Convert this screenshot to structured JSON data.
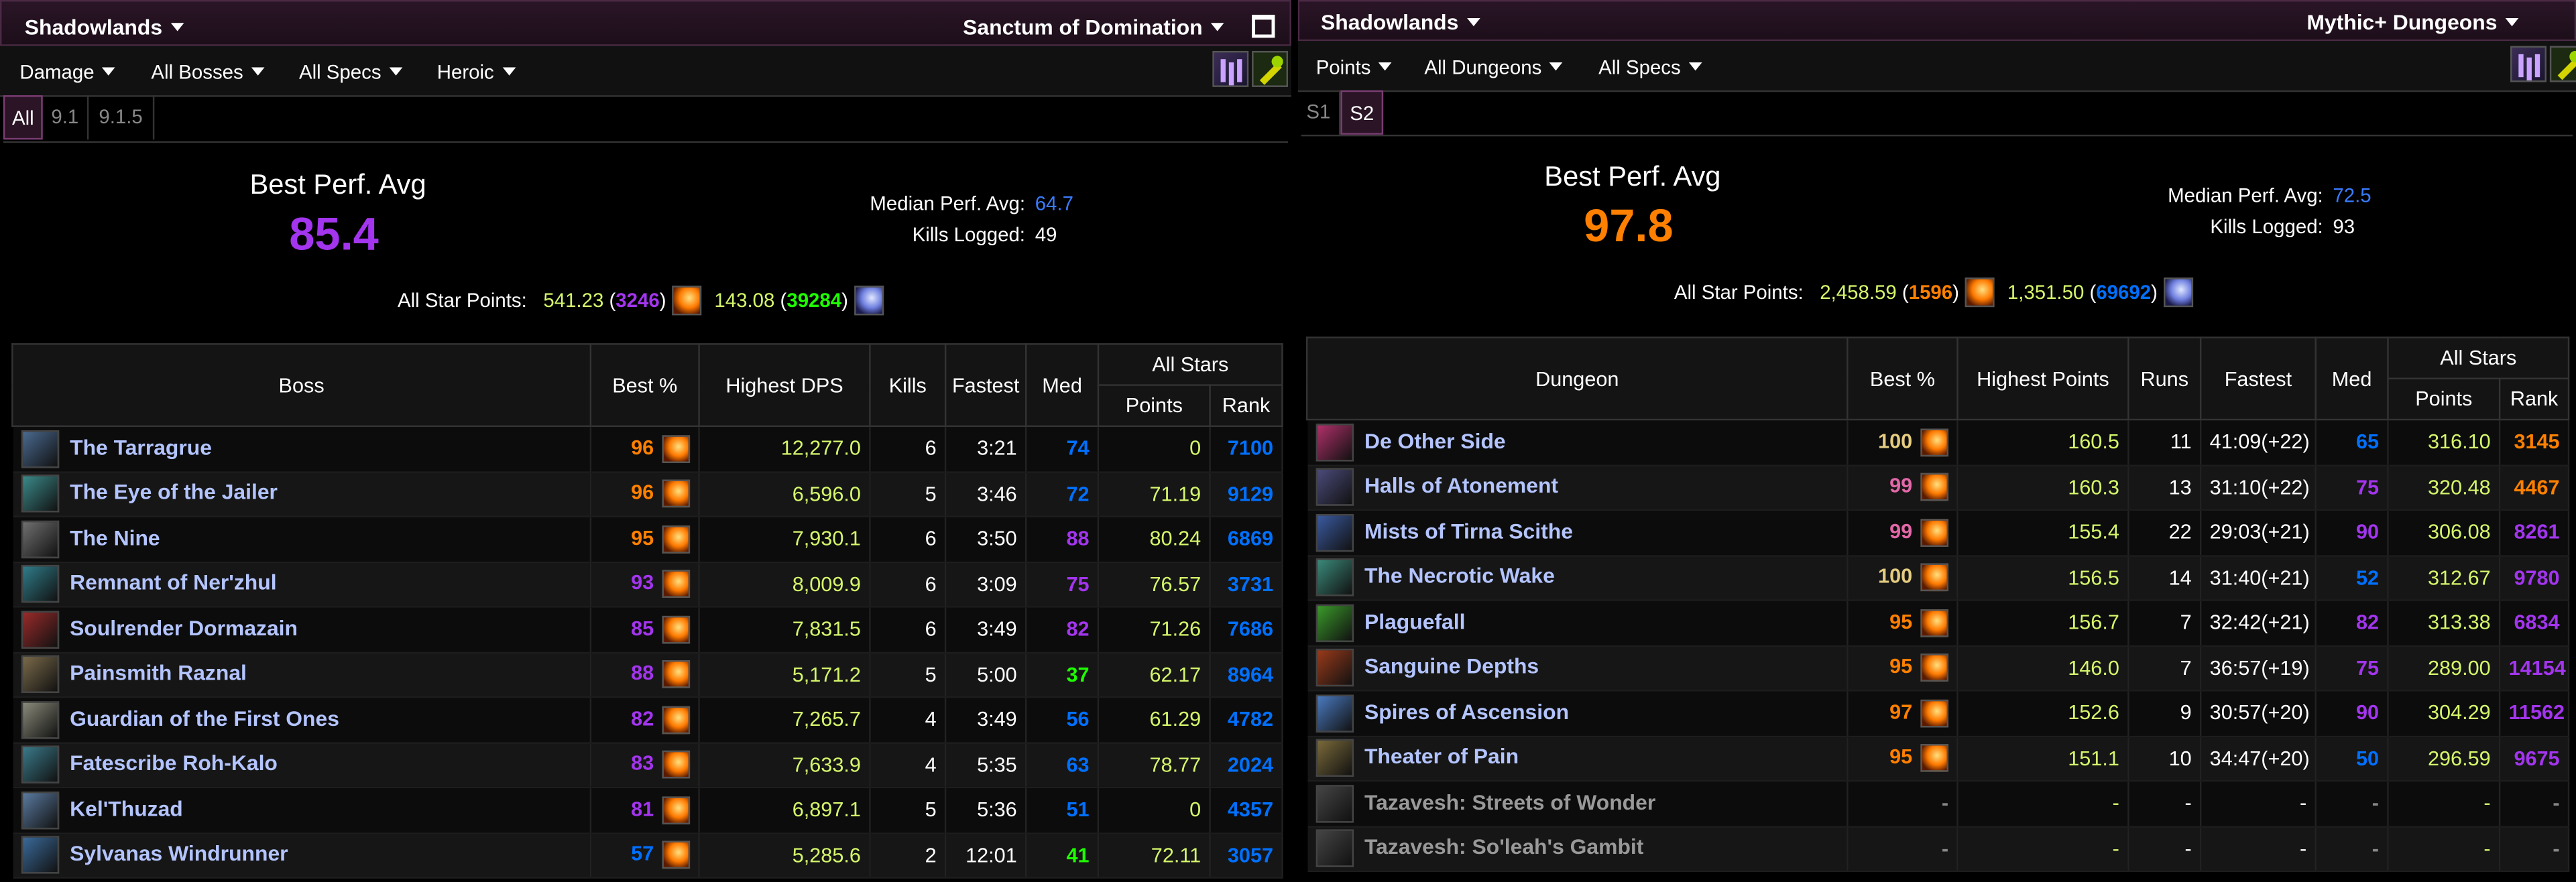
{
  "left": {
    "expansion": "Shadowlands",
    "zone": "Sanctum of Domination",
    "filters": [
      "Damage",
      "All Bosses",
      "All Specs",
      "Heroic"
    ],
    "tabs": [
      "All",
      "9.1",
      "9.1.5"
    ],
    "best_perf_label": "Best Perf. Avg",
    "best_perf_value": "85.4",
    "best_perf_color": "#a335ee",
    "median_label": "Median Perf. Avg:",
    "median_value": "64.7",
    "kills_label": "Kills Logged:",
    "kills_value": "49",
    "allstar_label": "All Star Points:",
    "allstar_1_points": "541.23",
    "allstar_1_rank": "3246",
    "allstar_1_rank_color": "#a335ee",
    "allstar_2_points": "143.08",
    "allstar_2_rank": "39284",
    "allstar_2_rank_color": "#1eff00",
    "headers": {
      "name": "Boss",
      "best": "Best %",
      "highest": "Highest DPS",
      "count": "Kills",
      "fastest": "Fastest",
      "med": "Med",
      "allstars": "All Stars",
      "points": "Points",
      "rank": "Rank"
    },
    "rows": [
      {
        "name": "The Tarragrue",
        "best": "96",
        "best_color": "#ff8000",
        "highest": "12,277.0",
        "count": "6",
        "fastest": "3:21",
        "med": "74",
        "med_color": "#0070ff",
        "points": "0",
        "rank": "7100",
        "rank_color": "#0070ff",
        "icon_color": "#4a6a90"
      },
      {
        "name": "The Eye of the Jailer",
        "best": "96",
        "best_color": "#ff8000",
        "highest": "6,596.0",
        "count": "5",
        "fastest": "3:46",
        "med": "72",
        "med_color": "#0070ff",
        "points": "71.19",
        "rank": "9129",
        "rank_color": "#0070ff",
        "icon_color": "#3b8a8a"
      },
      {
        "name": "The Nine",
        "best": "95",
        "best_color": "#ff8000",
        "highest": "7,930.1",
        "count": "6",
        "fastest": "3:50",
        "med": "88",
        "med_color": "#a335ee",
        "points": "80.24",
        "rank": "6869",
        "rank_color": "#0070ff",
        "icon_color": "#707070"
      },
      {
        "name": "Remnant of Ner'zhul",
        "best": "93",
        "best_color": "#a335ee",
        "highest": "8,009.9",
        "count": "6",
        "fastest": "3:09",
        "med": "75",
        "med_color": "#a335ee",
        "points": "76.57",
        "rank": "3731",
        "rank_color": "#0070ff",
        "icon_color": "#2f7d8a"
      },
      {
        "name": "Soulrender Dormazain",
        "best": "85",
        "best_color": "#a335ee",
        "highest": "7,831.5",
        "count": "6",
        "fastest": "3:49",
        "med": "82",
        "med_color": "#a335ee",
        "points": "71.26",
        "rank": "7686",
        "rank_color": "#0070ff",
        "icon_color": "#9a2a2a"
      },
      {
        "name": "Painsmith Raznal",
        "best": "88",
        "best_color": "#a335ee",
        "highest": "5,171.2",
        "count": "5",
        "fastest": "5:00",
        "med": "37",
        "med_color": "#1eff00",
        "points": "62.17",
        "rank": "8964",
        "rank_color": "#0070ff",
        "icon_color": "#7a6a4a"
      },
      {
        "name": "Guardian of the First Ones",
        "best": "82",
        "best_color": "#a335ee",
        "highest": "7,265.7",
        "count": "4",
        "fastest": "3:49",
        "med": "56",
        "med_color": "#0070ff",
        "points": "61.29",
        "rank": "4782",
        "rank_color": "#0070ff",
        "icon_color": "#8a8a7a"
      },
      {
        "name": "Fatescribe Roh-Kalo",
        "best": "83",
        "best_color": "#a335ee",
        "highest": "7,633.9",
        "count": "4",
        "fastest": "5:35",
        "med": "63",
        "med_color": "#0070ff",
        "points": "78.77",
        "rank": "2024",
        "rank_color": "#0070ff",
        "icon_color": "#3a7a8a"
      },
      {
        "name": "Kel'Thuzad",
        "best": "81",
        "best_color": "#a335ee",
        "highest": "6,897.1",
        "count": "5",
        "fastest": "5:36",
        "med": "51",
        "med_color": "#0070ff",
        "points": "0",
        "rank": "4357",
        "rank_color": "#0070ff",
        "icon_color": "#5a7aa0"
      },
      {
        "name": "Sylvanas Windrunner",
        "best": "57",
        "best_color": "#0070ff",
        "highest": "5,285.6",
        "count": "2",
        "fastest": "12:01",
        "med": "41",
        "med_color": "#1eff00",
        "points": "72.11",
        "rank": "3057",
        "rank_color": "#0070ff",
        "icon_color": "#3a6a9a"
      }
    ]
  },
  "right": {
    "expansion": "Shadowlands",
    "zone": "Mythic+ Dungeons",
    "filters": [
      "Points",
      "All Dungeons",
      "All Specs"
    ],
    "tabs": [
      "S1",
      "S2"
    ],
    "best_perf_label": "Best Perf. Avg",
    "best_perf_value": "97.8",
    "best_perf_color": "#ff8000",
    "median_label": "Median Perf. Avg:",
    "median_value": "72.5",
    "kills_label": "Kills Logged:",
    "kills_value": "93",
    "allstar_label": "All Star Points:",
    "allstar_1_points": "2,458.59",
    "allstar_1_rank": "1596",
    "allstar_1_rank_color": "#ff8000",
    "allstar_2_points": "1,351.50",
    "allstar_2_rank": "69692",
    "allstar_2_rank_color": "#0070ff",
    "headers": {
      "name": "Dungeon",
      "best": "Best %",
      "highest": "Highest Points",
      "count": "Runs",
      "fastest": "Fastest",
      "med": "Med",
      "allstars": "All Stars",
      "points": "Points",
      "rank": "Rank"
    },
    "rows": [
      {
        "name": "De Other Side",
        "best": "100",
        "best_color": "#e5cc80",
        "highest": "160.5",
        "count": "11",
        "fastest": "41:09(+22)",
        "med": "65",
        "med_color": "#0070ff",
        "points": "316.10",
        "rank": "3145",
        "rank_color": "#ff8000",
        "icon_color": "#b0306a"
      },
      {
        "name": "Halls of Atonement",
        "best": "99",
        "best_color": "#e268a8",
        "highest": "160.3",
        "count": "13",
        "fastest": "31:10(+22)",
        "med": "75",
        "med_color": "#a335ee",
        "points": "320.48",
        "rank": "4467",
        "rank_color": "#ff8000",
        "icon_color": "#4a4a7a"
      },
      {
        "name": "Mists of Tirna Scithe",
        "best": "99",
        "best_color": "#e268a8",
        "highest": "155.4",
        "count": "22",
        "fastest": "29:03(+21)",
        "med": "90",
        "med_color": "#a335ee",
        "points": "306.08",
        "rank": "8261",
        "rank_color": "#a335ee",
        "icon_color": "#3a5aa0"
      },
      {
        "name": "The Necrotic Wake",
        "best": "100",
        "best_color": "#e5cc80",
        "highest": "156.5",
        "count": "14",
        "fastest": "31:40(+21)",
        "med": "52",
        "med_color": "#0070ff",
        "points": "312.67",
        "rank": "9780",
        "rank_color": "#a335ee",
        "icon_color": "#3a8a7a"
      },
      {
        "name": "Plaguefall",
        "best": "95",
        "best_color": "#ff8000",
        "highest": "156.7",
        "count": "7",
        "fastest": "32:42(+21)",
        "med": "82",
        "med_color": "#a335ee",
        "points": "313.38",
        "rank": "6834",
        "rank_color": "#a335ee",
        "icon_color": "#3a9a2a"
      },
      {
        "name": "Sanguine Depths",
        "best": "95",
        "best_color": "#ff8000",
        "highest": "146.0",
        "count": "7",
        "fastest": "36:57(+19)",
        "med": "75",
        "med_color": "#a335ee",
        "points": "289.00",
        "rank": "14154",
        "rank_color": "#a335ee",
        "icon_color": "#9a3a1a"
      },
      {
        "name": "Spires of Ascension",
        "best": "97",
        "best_color": "#ff8000",
        "highest": "152.6",
        "count": "9",
        "fastest": "30:57(+20)",
        "med": "90",
        "med_color": "#a335ee",
        "points": "304.29",
        "rank": "11562",
        "rank_color": "#a335ee",
        "icon_color": "#4a7ac0"
      },
      {
        "name": "Theater of Pain",
        "best": "95",
        "best_color": "#ff8000",
        "highest": "151.1",
        "count": "10",
        "fastest": "34:47(+20)",
        "med": "50",
        "med_color": "#0070ff",
        "points": "296.59",
        "rank": "9675",
        "rank_color": "#a335ee",
        "icon_color": "#7a6a3a"
      },
      {
        "name": "Tazavesh: Streets of Wonder",
        "best": "-",
        "best_color": "#888888",
        "highest": "-",
        "count": "-",
        "fastest": "-",
        "med": "-",
        "med_color": "#888888",
        "points": "-",
        "rank": "-",
        "rank_color": "#888888",
        "icon_color": "#444444",
        "dim": true
      },
      {
        "name": "Tazavesh: So'leah's Gambit",
        "best": "-",
        "best_color": "#888888",
        "highest": "-",
        "count": "-",
        "fastest": "-",
        "med": "-",
        "med_color": "#888888",
        "points": "-",
        "rank": "-",
        "rank_color": "#888888",
        "icon_color": "#444444",
        "dim": true
      }
    ]
  }
}
